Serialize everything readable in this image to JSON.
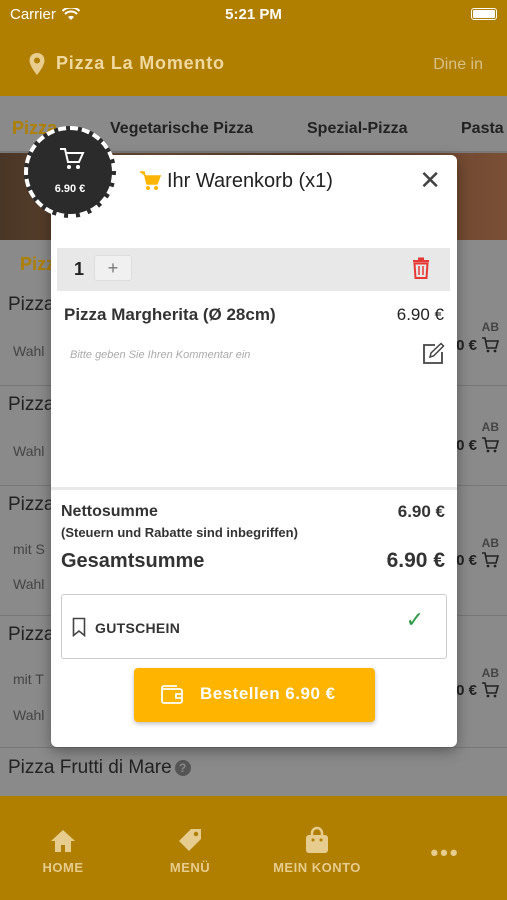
{
  "status": {
    "carrier": "Carrier",
    "time": "5:21 PM"
  },
  "header": {
    "title": "Pizza La Momento",
    "mode": "Dine in"
  },
  "tabs": [
    "Pizza",
    "Vegetarische Pizza",
    "Spezial-Pizza",
    "Pasta"
  ],
  "section": {
    "label": "Pizz"
  },
  "items": [
    {
      "name": "Pizza",
      "sub1": "Wahl",
      "sub2": "",
      "ab": "AB",
      "price": "0 €"
    },
    {
      "name": "Pizza",
      "sub1": "Wahl",
      "sub2": "",
      "ab": "AB",
      "price": "0 €"
    },
    {
      "name": "Pizza",
      "sub1": "mit S",
      "sub2": "Wahl",
      "ab": "AB",
      "price": "0 €"
    },
    {
      "name": "Pizza",
      "sub1": "mit T",
      "sub2": "Wahl",
      "ab": "AB",
      "price": "0 €"
    }
  ],
  "frutti": {
    "name": "Pizza Frutti di Mare"
  },
  "badge": {
    "price": "6.90 €"
  },
  "cart": {
    "title": "Ihr Warenkorb (x1)",
    "quantity": "1",
    "plus": "+",
    "item_name": "Pizza Margherita (Ø 28cm)",
    "item_price": "6.90 €",
    "comment_placeholder": "Bitte geben Sie Ihren Kommentar ein",
    "net_label": "Nettosumme",
    "net_price": "6.90 €",
    "net_note": "(Steuern und Rabatte sind inbegriffen)",
    "total_label": "Gesamtsumme",
    "total_price": "6.90 €",
    "voucher_label": "GUTSCHEIN",
    "order_label": "Bestellen 6.90 €"
  },
  "nav": [
    "HOME",
    "MENÜ",
    "MEIN KONTO"
  ],
  "colors": {
    "brand": "#b07f00",
    "accent": "#ffb400",
    "delete": "#e53935",
    "check": "#2e9a45"
  }
}
